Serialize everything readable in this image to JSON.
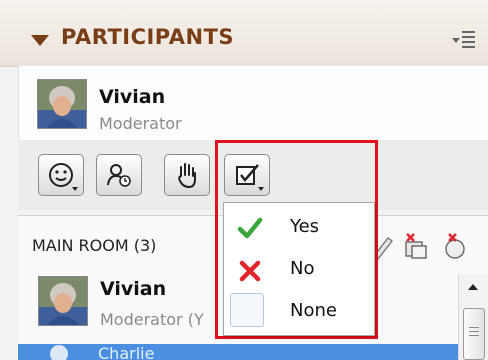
{
  "panel": {
    "title": "PARTICIPANTS"
  },
  "current_user": {
    "name": "Vivian",
    "role": "Moderator"
  },
  "toolbar": {
    "buttons": [
      "status-emoticon",
      "step-away",
      "raise-hand",
      "agree-disagree"
    ]
  },
  "status_menu": {
    "options": [
      {
        "label": "Yes",
        "icon": "check-icon",
        "color": "#3aa63a"
      },
      {
        "label": "No",
        "icon": "x-icon",
        "color": "#e0262b"
      },
      {
        "label": "None",
        "icon": "empty-box-icon"
      }
    ]
  },
  "room": {
    "title": "MAIN ROOM (3)",
    "participants": [
      {
        "name": "Vivian",
        "role": "Moderator (Y"
      },
      {
        "name": "Charlie"
      }
    ]
  },
  "colors": {
    "header_text": "#7a3e16",
    "highlight": "#e0121d",
    "selected_row": "#4a8fe0"
  }
}
